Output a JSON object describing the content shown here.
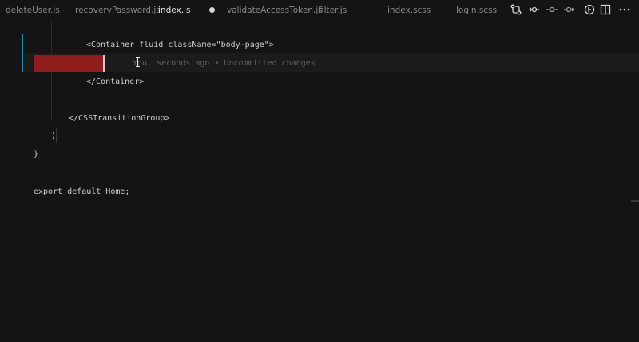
{
  "tabs": [
    {
      "label": "deleteUser.js"
    },
    {
      "label": "recoveryPassword.js"
    },
    {
      "label": "index.js",
      "active": true,
      "modified": true
    },
    {
      "label": "validateAccessToken.js"
    },
    {
      "label": "filter.js"
    },
    {
      "label": "index.scss"
    },
    {
      "label": "login.scss"
    }
  ],
  "tab_actions": [
    "source-control-compare-icon",
    "git-commit-icon",
    "git-commit-icon",
    "git-commit-forward-icon",
    "gitlens-icon",
    "split-editor-icon",
    "more-actions-icon"
  ],
  "editor": {
    "lines": [
      "<Container fluid className=\"body-page\">",
      "</Container>",
      "</CSSTransitionGroup>",
      ")",
      "}",
      "export default Home;"
    ],
    "blame": "You, seconds ago • Uncommitted changes"
  },
  "colors": {
    "background": "#141414",
    "selection": "#8f1d1d",
    "gutter_accent": "#1e8fb3"
  }
}
